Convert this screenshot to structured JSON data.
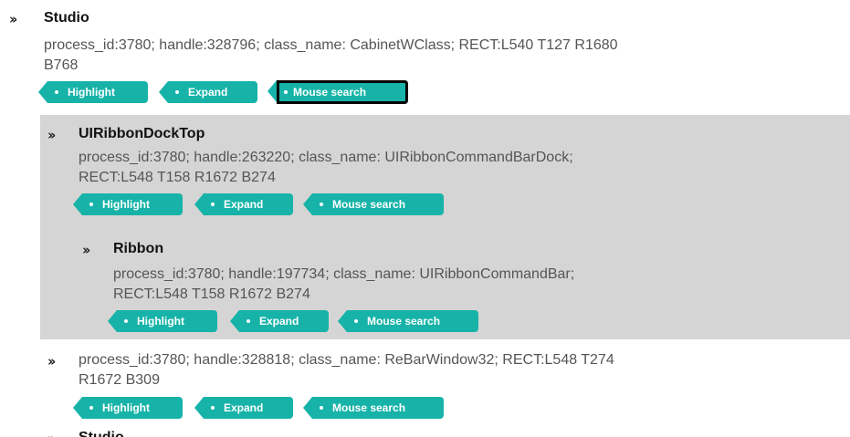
{
  "nodes": {
    "studio": {
      "title": "Studio",
      "desc_line1": "process_id:3780; handle:328796; class_name: CabinetWClass; RECT:L540 T127 R1680",
      "desc_line2": "B768"
    },
    "ribbon_dock": {
      "title": "UIRibbonDockTop",
      "desc_line1": "process_id:3780; handle:263220; class_name: UIRibbonCommandBarDock;",
      "desc_line2": "RECT:L548 T158 R1672 B274"
    },
    "ribbon": {
      "title": "Ribbon",
      "desc_line1": "process_id:3780; handle:197734; class_name: UIRibbonCommandBar;",
      "desc_line2": "RECT:L548 T158 R1672 B274"
    },
    "rebar": {
      "desc_line1": "process_id:3780; handle:328818; class_name: ReBarWindow32; RECT:L548 T274",
      "desc_line2": "R1672 B309"
    },
    "studio2": {
      "title": "Studio"
    }
  },
  "buttons": {
    "highlight": "Highlight",
    "expand": "Expand",
    "mouse_search": "Mouse search"
  },
  "icons": {
    "expand_chevron": "double-chevron-right-icon"
  },
  "colors": {
    "tag_bg": "#17b3a8",
    "selected_block_bg": "#d5d5d5"
  }
}
